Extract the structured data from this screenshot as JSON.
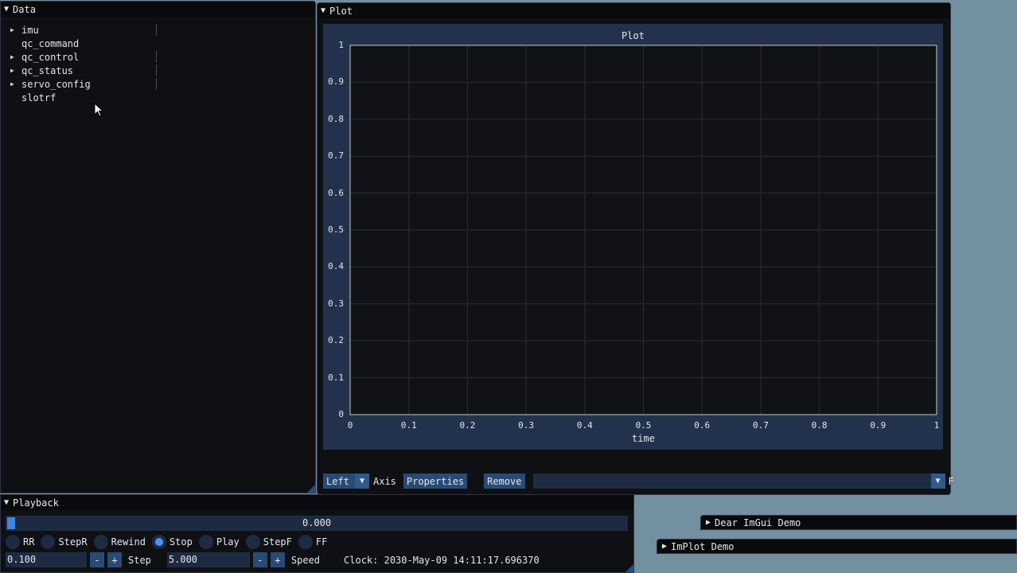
{
  "colors": {
    "background": "#72909f",
    "window": "#0f1014",
    "frame": "#23324c",
    "button": "#284b75",
    "accent": "#4296fa"
  },
  "data_window": {
    "title": "Data",
    "toggle_icon": "triangle-down",
    "items": [
      {
        "label": "imu",
        "expandable": true
      },
      {
        "label": "qc_command",
        "expandable": false
      },
      {
        "label": "qc_control",
        "expandable": true
      },
      {
        "label": "qc_status",
        "expandable": true
      },
      {
        "label": "servo_config",
        "expandable": true
      },
      {
        "label": "slotrf",
        "expandable": false
      }
    ]
  },
  "plot_window": {
    "title": "Plot",
    "axis_select": "Left",
    "axis_label": "Axis",
    "properties_label": "Properties",
    "remove_label": "Remove",
    "trailing_char": "F"
  },
  "chart_data": {
    "type": "line",
    "title": "Plot",
    "xlabel": "time",
    "ylabel": "",
    "xlim": [
      0,
      1
    ],
    "ylim": [
      0,
      1
    ],
    "x_ticks": [
      "0",
      "0.1",
      "0.2",
      "0.3",
      "0.4",
      "0.5",
      "0.6",
      "0.7",
      "0.8",
      "0.9",
      "1"
    ],
    "y_ticks": [
      "0",
      "0.1",
      "0.2",
      "0.3",
      "0.4",
      "0.5",
      "0.6",
      "0.7",
      "0.8",
      "0.9",
      "1"
    ],
    "grid": true,
    "series": []
  },
  "playback": {
    "title": "Playback",
    "slider_value": "0.000",
    "modes": [
      "RR",
      "StepR",
      "Rewind",
      "Stop",
      "Play",
      "StepF",
      "FF"
    ],
    "selected_mode": "Stop",
    "step_value": "0.100",
    "step_label": "Step",
    "speed_value": "5.000",
    "speed_label": "Speed",
    "minus": "-",
    "plus": "+",
    "clock": "Clock: 2030-May-09 14:11:17.696370"
  },
  "collapsed_windows": {
    "imgui_demo": "Dear ImGui Demo",
    "implot_demo": "ImPlot Demo"
  }
}
